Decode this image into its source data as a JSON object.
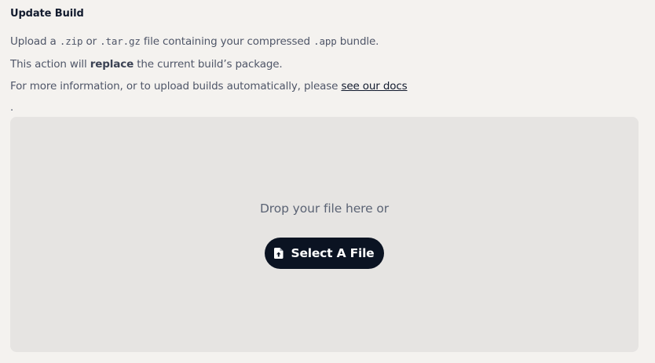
{
  "header": {
    "title": "Update Build"
  },
  "description": {
    "line1": {
      "t1": "Upload a ",
      "zip": ".zip",
      "t2": " or ",
      "targz": ".tar.gz",
      "t3": " file containing your compressed ",
      "app": ".app",
      "t4": " bundle."
    },
    "line2": {
      "t1": "This action will ",
      "bold": "replace",
      "t2": " the current build’s package."
    },
    "line3": {
      "t1": "For more information, or to upload builds automatically, please ",
      "link": "see our docs"
    },
    "trailing_dot": "."
  },
  "dropzone": {
    "prompt": "Drop your file here or",
    "button_label": "Select A File",
    "button_icon": "file-upload-icon"
  },
  "colors": {
    "background": "#f4f2ef",
    "dropzone": "#e6e4e2",
    "button": "#0b1322",
    "title": "#121b2e"
  }
}
